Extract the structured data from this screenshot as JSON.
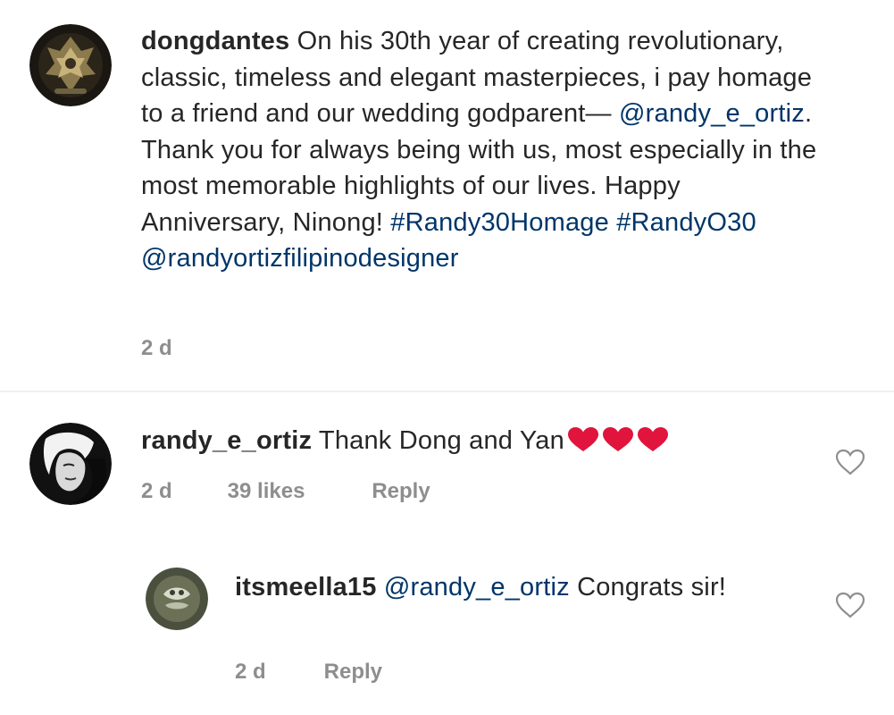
{
  "comments": [
    {
      "username": "dongdantes",
      "text_parts": [
        {
          "t": "On his 30th year of creating revolutionary, classic, timeless and elegant masterpieces, i pay homage to a friend and our wedding godparent— ",
          "k": "plain"
        },
        {
          "t": "@randy_e_ortiz",
          "k": "mention"
        },
        {
          "t": ". Thank you for always being with us, most especially in the most memorable highlights of our lives. Happy Anniversary, Ninong! ",
          "k": "plain"
        },
        {
          "t": "#Randy30Homage",
          "k": "hashtag"
        },
        {
          "t": " ",
          "k": "plain"
        },
        {
          "t": "#RandyO30",
          "k": "hashtag"
        },
        {
          "t": " ",
          "k": "plain"
        },
        {
          "t": "@randyortizfilipinodesigner",
          "k": "mention"
        }
      ],
      "time": "2 d"
    },
    {
      "username": "randy_e_ortiz",
      "text": "Thank Dong and Yan",
      "emoji": [
        "red-heart",
        "red-heart",
        "red-heart"
      ],
      "time": "2 d",
      "likes": "39 likes",
      "reply": "Reply"
    },
    {
      "username": "itsmeella15",
      "mention": "@randy_e_ortiz",
      "text": "Congrats sir!",
      "time": "2 d",
      "reply": "Reply"
    }
  ],
  "colors": {
    "text": "#262626",
    "link": "#003569",
    "meta": "#8e8e8e",
    "heart_emoji": "#e0143c",
    "divider": "#efefef"
  }
}
